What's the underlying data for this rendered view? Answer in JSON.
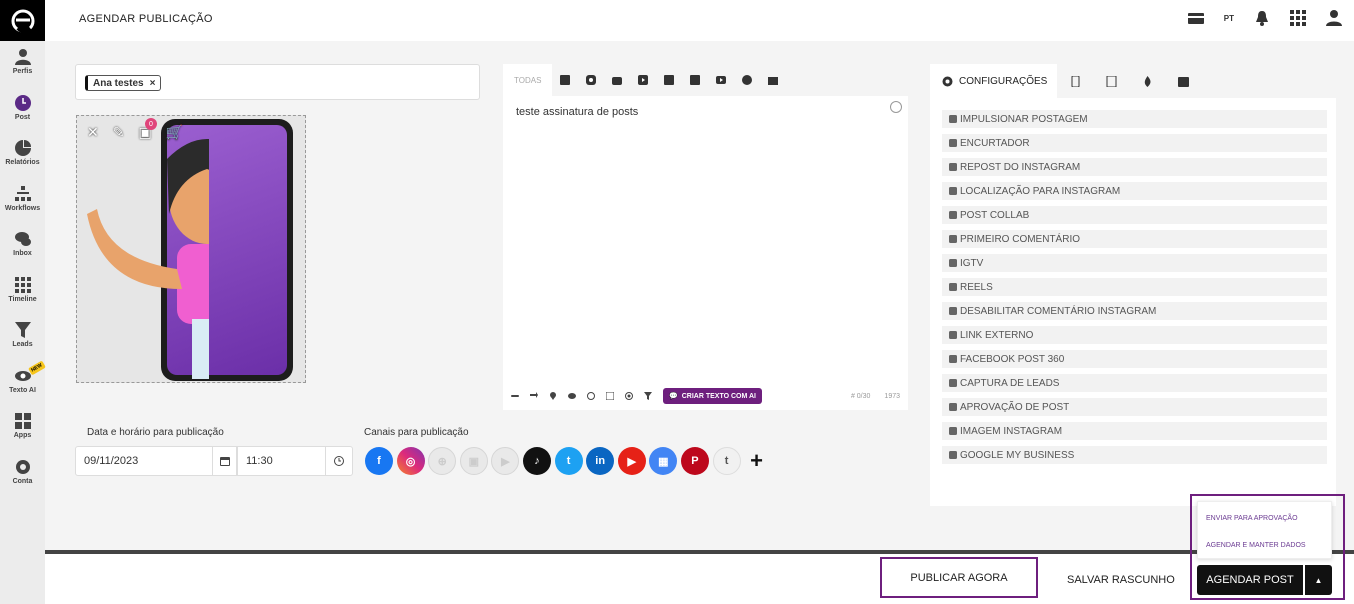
{
  "app": {
    "title": "AGENDAR PUBLICAÇÃO",
    "lang": "PT"
  },
  "sidebar": {
    "items": [
      {
        "label": "Perfis",
        "icon": "user-icon"
      },
      {
        "label": "Post",
        "icon": "clock-icon"
      },
      {
        "label": "Relatórios",
        "icon": "pie-chart-icon"
      },
      {
        "label": "Workflows",
        "icon": "sitemap-icon"
      },
      {
        "label": "Inbox",
        "icon": "chat-icon"
      },
      {
        "label": "Timeline",
        "icon": "grid-icon"
      },
      {
        "label": "Leads",
        "icon": "filter-icon"
      },
      {
        "label": "Texto AI",
        "icon": "ai-eye-icon",
        "badge": "NEW"
      },
      {
        "label": "Apps",
        "icon": "apps-icon"
      },
      {
        "label": "Conta",
        "icon": "gear-icon"
      }
    ]
  },
  "profiles": {
    "tag": "Ana testes",
    "remove": "×"
  },
  "media": {
    "count": "0"
  },
  "editor": {
    "tab_all": "TODAS",
    "text": "teste assinatura de posts",
    "ai_button": "CRIAR TEXTO COM AI",
    "counter": "# 0/30",
    "chars": "1973"
  },
  "schedule": {
    "date_label": "Data e horário para publicação",
    "date": "09/11/2023",
    "time": "11:30"
  },
  "channels": {
    "label": "Canais para publicação",
    "add": "+",
    "items": [
      {
        "name": "facebook",
        "glyph": "f",
        "color": "#1877f2",
        "enabled": true
      },
      {
        "name": "instagram",
        "glyph": "◎",
        "color": "#d6249f",
        "enabled": true
      },
      {
        "name": "threads",
        "glyph": "⊕",
        "color": "#e9e9e9",
        "enabled": false
      },
      {
        "name": "igtv",
        "glyph": "▣",
        "color": "#e9e9e9",
        "enabled": false
      },
      {
        "name": "reels",
        "glyph": "▶",
        "color": "#e9e9e9",
        "enabled": false
      },
      {
        "name": "tiktok",
        "glyph": "♪",
        "color": "#111111",
        "enabled": true
      },
      {
        "name": "twitter",
        "glyph": "t",
        "color": "#1da1f2",
        "enabled": true
      },
      {
        "name": "linkedin",
        "glyph": "in",
        "color": "#0a66c2",
        "enabled": true
      },
      {
        "name": "youtube",
        "glyph": "▶",
        "color": "#e62117",
        "enabled": true
      },
      {
        "name": "google-my-business",
        "glyph": "▦",
        "color": "#4285f4",
        "enabled": true
      },
      {
        "name": "pinterest",
        "glyph": "P",
        "color": "#bd081c",
        "enabled": true
      },
      {
        "name": "tumblr",
        "glyph": "t",
        "color": "#f1f1f1",
        "enabled": true
      }
    ]
  },
  "config": {
    "tab": "CONFIGURAÇÕES",
    "options": [
      "IMPULSIONAR POSTAGEM",
      "ENCURTADOR",
      "REPOST DO INSTAGRAM",
      "LOCALIZAÇÃO PARA INSTAGRAM",
      "POST COLLAB",
      "PRIMEIRO COMENTÁRIO",
      "IGTV",
      "REELS",
      "DESABILITAR COMENTÁRIO INSTAGRAM",
      "LINK EXTERNO",
      "FACEBOOK POST 360",
      "CAPTURA DE LEADS",
      "APROVAÇÃO DE POST",
      "IMAGEM INSTAGRAM",
      "GOOGLE MY BUSINESS"
    ]
  },
  "actions": {
    "publish_now": "PUBLICAR AGORA",
    "save_draft": "SALVAR RASCUNHO",
    "schedule": "AGENDAR POST",
    "menu": [
      "ENVIAR PARA APROVAÇÃO",
      "AGENDAR E MANTER DADOS"
    ]
  },
  "colors": {
    "accent": "#6e1f7e",
    "sidebar_active": "#5b2a86"
  }
}
